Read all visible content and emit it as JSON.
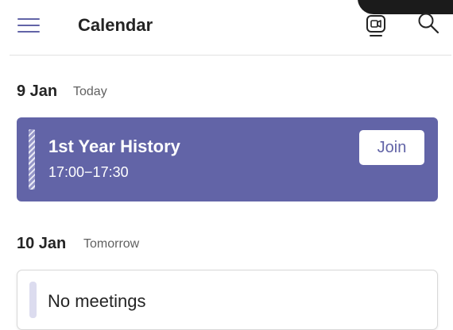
{
  "header": {
    "title": "Calendar",
    "menu_icon": "hamburger-menu-icon",
    "meet_now_icon": "video-meeting-icon",
    "search_icon": "search-icon"
  },
  "days": [
    {
      "date": "9 Jan",
      "relative": "Today",
      "events": [
        {
          "title": "1st Year History",
          "time": "17:00−17:30",
          "action_label": "Join"
        }
      ]
    },
    {
      "date": "10 Jan",
      "relative": "Tomorrow",
      "empty_text": "No meetings"
    }
  ],
  "colors": {
    "accent": "#6264a7",
    "event_card_bg": "#6264a7",
    "text_primary": "#242424",
    "text_secondary": "#616161"
  }
}
